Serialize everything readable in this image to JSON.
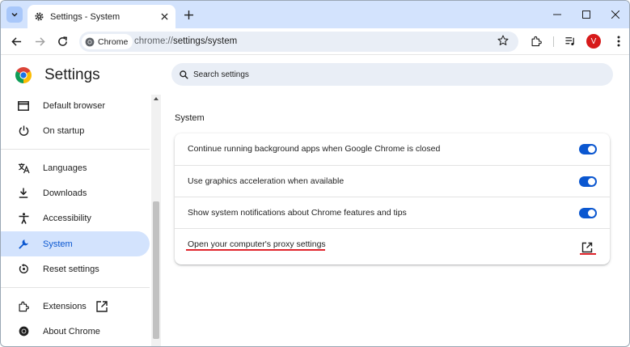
{
  "browser": {
    "tab_title": "Settings - System",
    "chip_label": "Chrome",
    "url_prefix": "chrome://",
    "url_path": "settings/system",
    "avatar_letter": "V",
    "avatar_color": "#d71a1a"
  },
  "header": {
    "title": "Settings",
    "search_placeholder": "Search settings"
  },
  "sidebar": {
    "items": [
      {
        "label": "Default browser",
        "icon": "browser-window-icon"
      },
      {
        "label": "On startup",
        "icon": "power-icon"
      },
      {
        "label": "Languages",
        "icon": "translate-icon"
      },
      {
        "label": "Downloads",
        "icon": "download-icon"
      },
      {
        "label": "Accessibility",
        "icon": "accessibility-icon"
      },
      {
        "label": "System",
        "icon": "wrench-icon",
        "active": true
      },
      {
        "label": "Reset settings",
        "icon": "reset-icon"
      },
      {
        "label": "Extensions",
        "icon": "puzzle-icon"
      },
      {
        "label": "About Chrome",
        "icon": "chrome-icon"
      }
    ]
  },
  "main": {
    "section_title": "System",
    "rows": [
      {
        "label": "Continue running background apps when Google Chrome is closed",
        "toggle": true
      },
      {
        "label": "Use graphics acceleration when available",
        "toggle": true
      },
      {
        "label": "Show system notifications about Chrome features and tips",
        "toggle": true
      },
      {
        "label": "Open your computer's proxy settings",
        "external": true
      }
    ]
  },
  "colors": {
    "accent": "#0b57d0",
    "active_nav_bg": "#d3e3fd",
    "annotation_red": "#e0242b"
  }
}
